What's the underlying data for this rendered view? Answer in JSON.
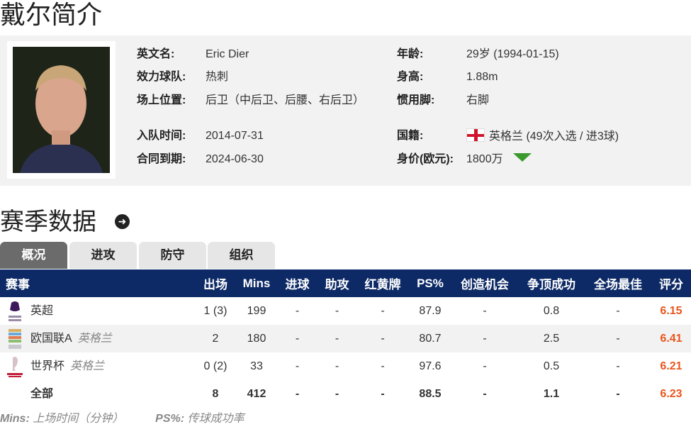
{
  "title": "戴尔简介",
  "profile": {
    "left": [
      {
        "label": "英文名:",
        "value": "Eric Dier"
      },
      {
        "label": "效力球队:",
        "value": "热刺"
      },
      {
        "label": "场上位置:",
        "value": "后卫（中后卫、后腰、右后卫）"
      },
      {
        "label": "入队时间:",
        "value": "2014-07-31"
      },
      {
        "label": "合同到期:",
        "value": "2024-06-30"
      }
    ],
    "right": [
      {
        "label": "年龄:",
        "value": "29岁 (1994-01-15)"
      },
      {
        "label": "身高:",
        "value": "1.88m"
      },
      {
        "label": "惯用脚:",
        "value": "右脚"
      },
      {
        "label": "国籍:",
        "value": "英格兰 (49次入选 / 进3球)",
        "icon": "england-flag-icon"
      },
      {
        "label": "身价(欧元):",
        "value": "1800万",
        "icon": "trend-down-icon",
        "trend_color": "#3a9a2e"
      }
    ]
  },
  "section_title": "赛季数据",
  "tabs": [
    "概况",
    "进攻",
    "防守",
    "组织"
  ],
  "active_tab": "概况",
  "table": {
    "headers": [
      "赛事",
      "出场",
      "Mins",
      "进球",
      "助攻",
      "红黄牌",
      "PS%",
      "创造机会",
      "争顶成功",
      "全场最佳",
      "评分"
    ],
    "rows": [
      {
        "comp": "英超",
        "team": "",
        "icon": "premier-league-logo",
        "cells": [
          "1 (3)",
          "199",
          "-",
          "-",
          "-",
          "87.9",
          "-",
          "0.8",
          "-",
          "6.15"
        ]
      },
      {
        "comp": "欧国联A",
        "team": "英格兰",
        "icon": "nations-league-logo",
        "cells": [
          "2",
          "180",
          "-",
          "-",
          "-",
          "80.7",
          "-",
          "2.5",
          "-",
          "6.41"
        ]
      },
      {
        "comp": "世界杯",
        "team": "英格兰",
        "icon": "world-cup-logo",
        "cells": [
          "0 (2)",
          "33",
          "-",
          "-",
          "-",
          "97.6",
          "-",
          "0.5",
          "-",
          "6.21"
        ]
      }
    ],
    "total": {
      "comp": "全部",
      "cells": [
        "8",
        "412",
        "-",
        "-",
        "-",
        "88.5",
        "-",
        "1.1",
        "-",
        "6.23"
      ]
    }
  },
  "notes": [
    {
      "key": "Mins:",
      "text": "上场时间（分钟）"
    },
    {
      "key": "PS%:",
      "text": "传球成功率"
    }
  ],
  "colors": {
    "header_bg": "#0d2a66",
    "rating": "#e8561e",
    "active_tab": "#6b6b6b"
  }
}
